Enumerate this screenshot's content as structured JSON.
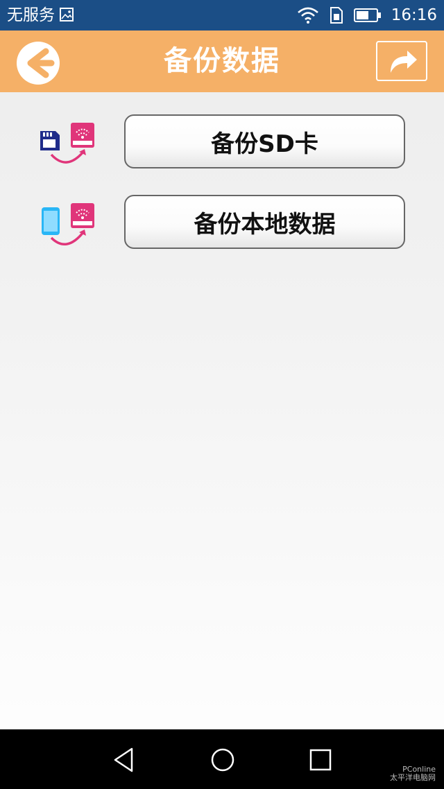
{
  "status_bar": {
    "carrier": "无服务",
    "time": "16:16",
    "icons": [
      "photo-notification-icon",
      "wifi-icon",
      "sim-card-icon",
      "battery-icon"
    ]
  },
  "header": {
    "title": "备份数据",
    "back_icon": "back-arrow-icon",
    "share_icon": "share-arrow-icon",
    "background_color": "#f5b067"
  },
  "actions": [
    {
      "label": "备份SD卡",
      "icon": "sd-card-to-device-icon"
    },
    {
      "label": "备份本地数据",
      "icon": "phone-to-device-icon"
    }
  ],
  "nav_bar": {
    "icons": [
      "back-triangle-icon",
      "home-circle-icon",
      "recents-square-icon"
    ]
  },
  "watermark": {
    "line1": "PConline",
    "line2": "太平洋电脑网"
  },
  "colors": {
    "status_bar": "#1b4e86",
    "accent_pink": "#e0357a",
    "sd_card_blue": "#1f2c8a",
    "phone_cyan": "#29b6f6"
  }
}
